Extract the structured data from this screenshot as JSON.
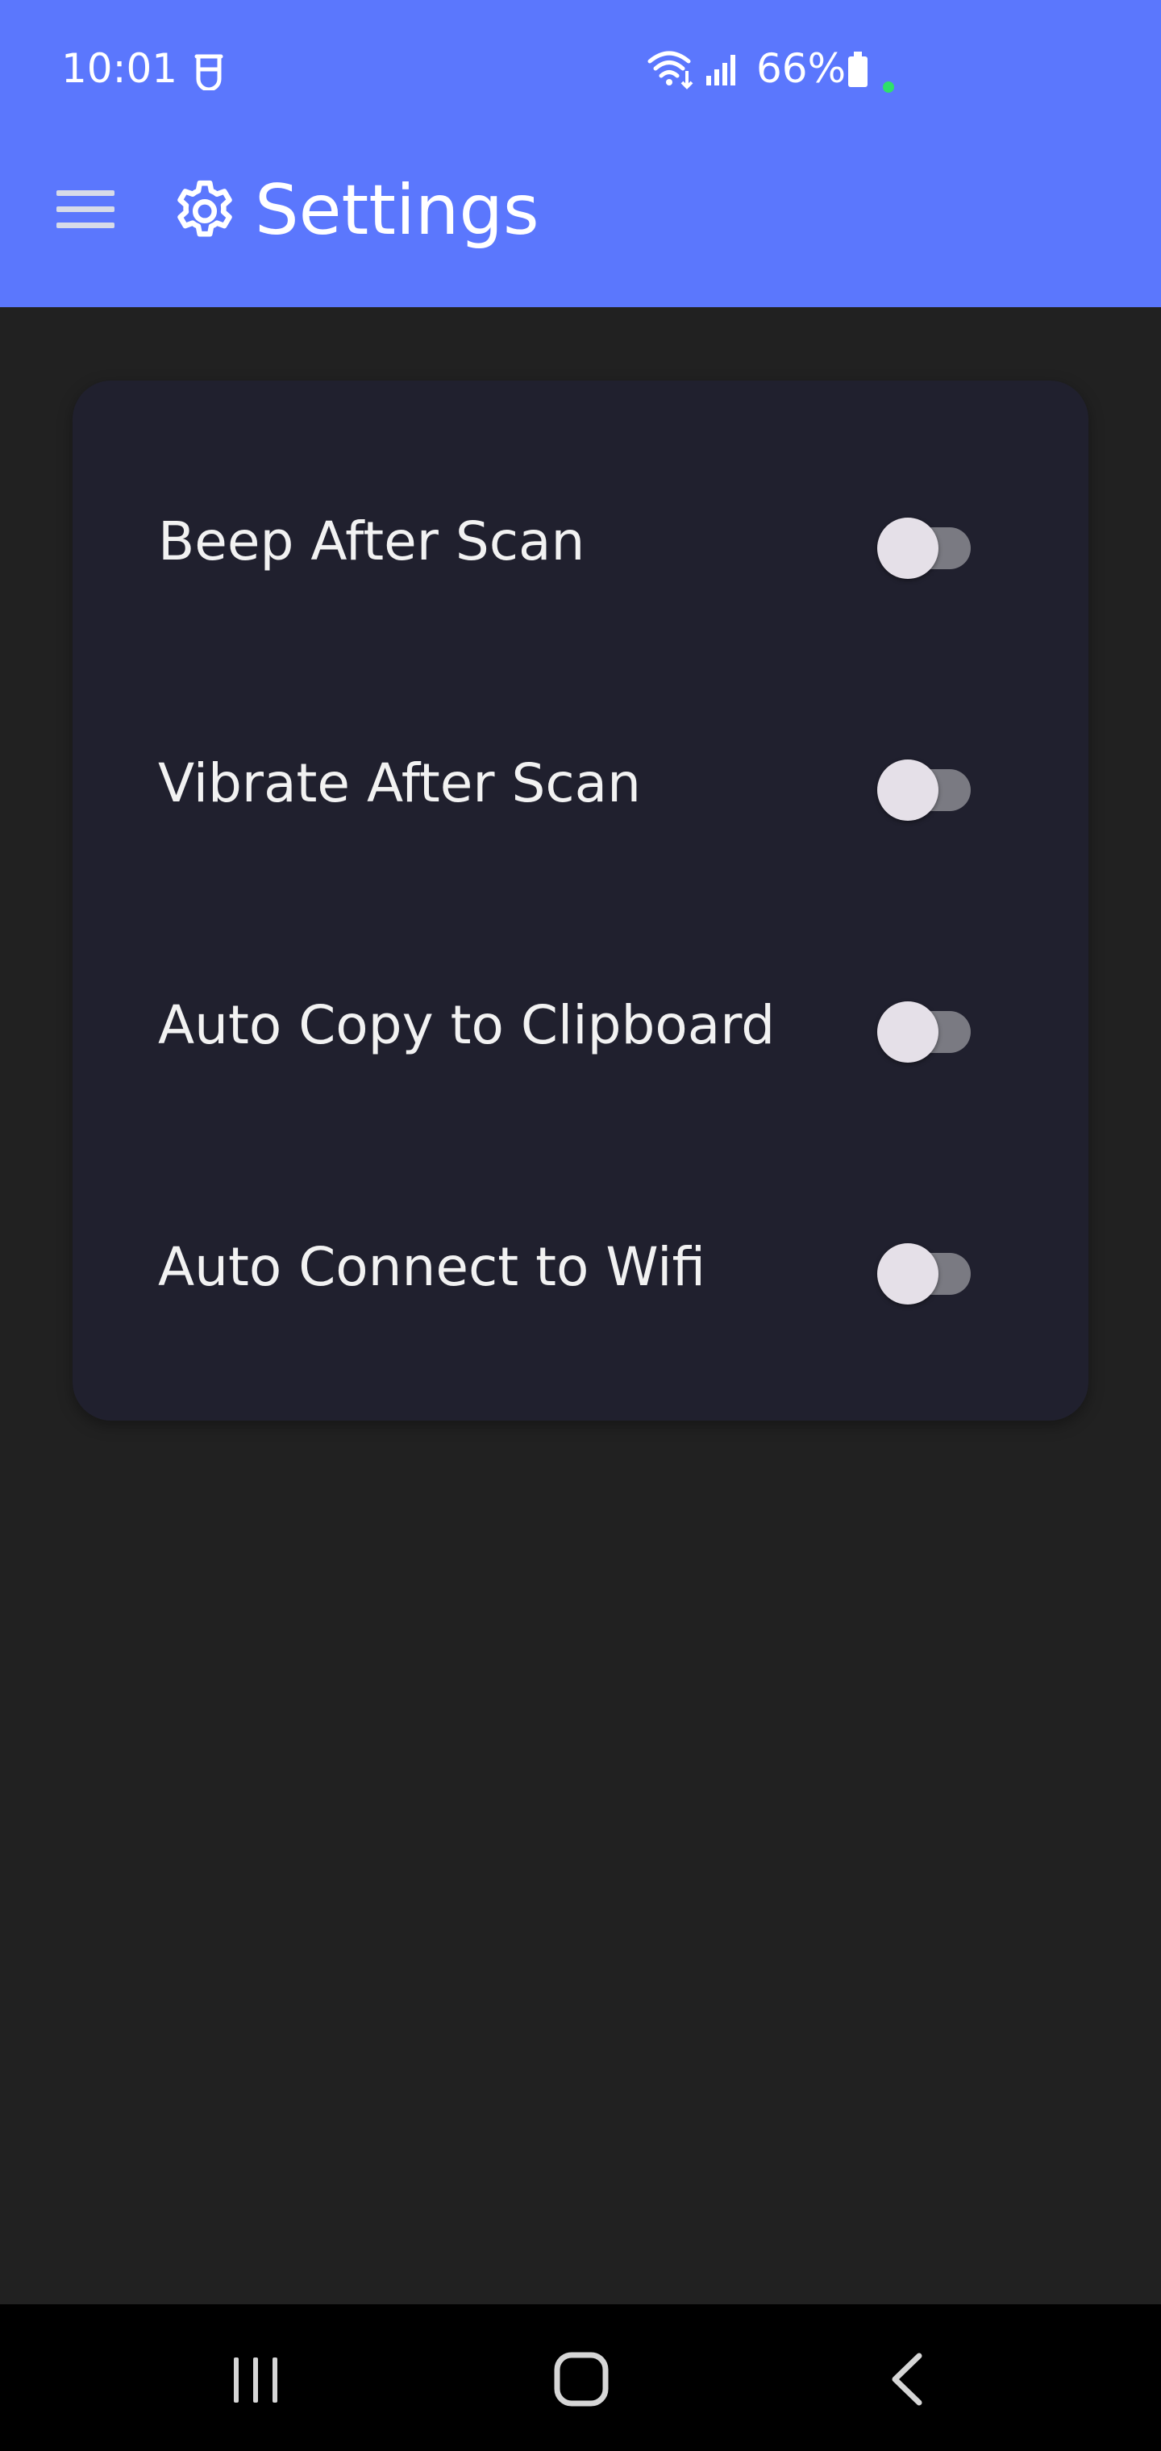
{
  "status_bar": {
    "time": "10:01",
    "battery_percent": "66%",
    "app_icon": "notification-app-icon",
    "icons": [
      "wifi-icon",
      "signal-icon",
      "battery-icon"
    ]
  },
  "app_bar": {
    "title": "Settings",
    "menu_icon": "hamburger-menu-icon",
    "title_icon": "gear-icon",
    "background_color": "#5b77fd"
  },
  "settings": [
    {
      "label": "Beep After Scan",
      "enabled": false
    },
    {
      "label": "Vibrate After Scan",
      "enabled": false
    },
    {
      "label": "Auto Copy to Clipboard",
      "enabled": false
    },
    {
      "label": "Auto Connect to Wifi",
      "enabled": false
    }
  ],
  "nav_bar": {
    "icons": [
      "recents-icon",
      "home-icon",
      "back-icon"
    ]
  },
  "colors": {
    "background": "#212121",
    "card": "#20202e",
    "accent": "#5b77fd"
  }
}
